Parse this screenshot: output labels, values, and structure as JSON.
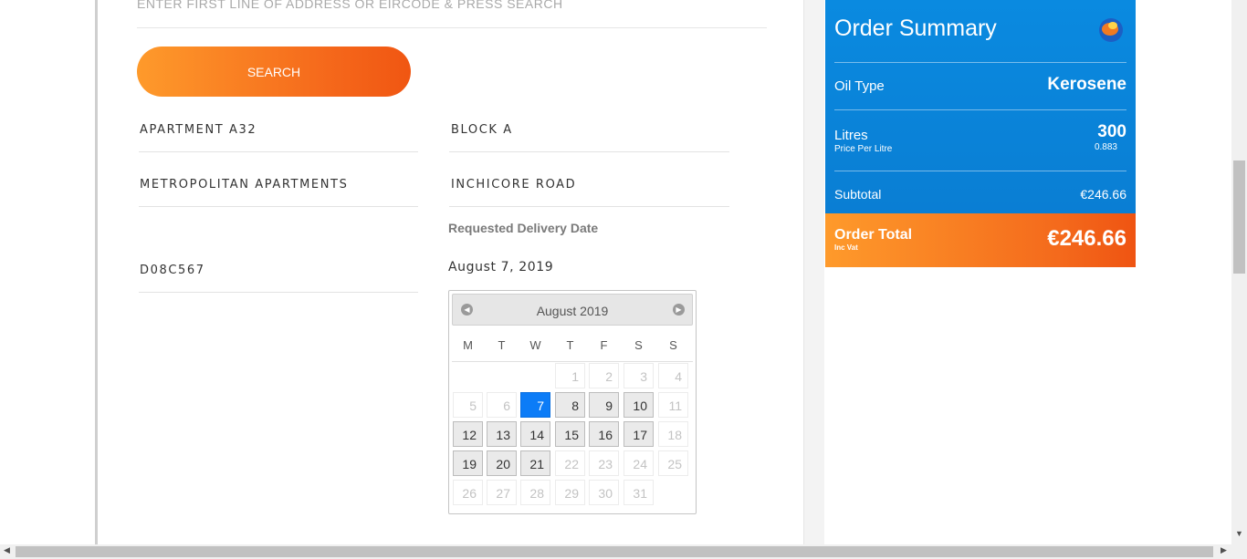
{
  "address": {
    "placeholder": "ENTER FIRST LINE OF ADDRESS OR EIRCODE & PRESS SEARCH",
    "search_label": "SEARCH",
    "line1": "APARTMENT A32",
    "line2": "BLOCK A",
    "line3": "METROPOLITAN APARTMENTS",
    "line4": "INCHICORE ROAD",
    "eircode": "D08C567"
  },
  "delivery": {
    "label": "Requested Delivery Date",
    "value": "August 7, 2019"
  },
  "calendar": {
    "title": "August 2019",
    "prev_icon": "prev-arrow-icon",
    "next_icon": "next-arrow-icon",
    "weekdays": [
      "M",
      "T",
      "W",
      "T",
      "F",
      "S",
      "S"
    ],
    "weeks": [
      [
        null,
        null,
        null,
        {
          "d": "1",
          "s": "off"
        },
        {
          "d": "2",
          "s": "off"
        },
        {
          "d": "3",
          "s": "off"
        },
        {
          "d": "4",
          "s": "off"
        }
      ],
      [
        {
          "d": "5",
          "s": "off"
        },
        {
          "d": "6",
          "s": "off"
        },
        {
          "d": "7",
          "s": "sel"
        },
        {
          "d": "8",
          "s": "on"
        },
        {
          "d": "9",
          "s": "on"
        },
        {
          "d": "10",
          "s": "on"
        },
        {
          "d": "11",
          "s": "off"
        }
      ],
      [
        {
          "d": "12",
          "s": "on"
        },
        {
          "d": "13",
          "s": "on"
        },
        {
          "d": "14",
          "s": "on"
        },
        {
          "d": "15",
          "s": "on"
        },
        {
          "d": "16",
          "s": "on"
        },
        {
          "d": "17",
          "s": "on"
        },
        {
          "d": "18",
          "s": "off"
        }
      ],
      [
        {
          "d": "19",
          "s": "on"
        },
        {
          "d": "20",
          "s": "on"
        },
        {
          "d": "21",
          "s": "on"
        },
        {
          "d": "22",
          "s": "off"
        },
        {
          "d": "23",
          "s": "off"
        },
        {
          "d": "24",
          "s": "off"
        },
        {
          "d": "25",
          "s": "off"
        }
      ],
      [
        {
          "d": "26",
          "s": "off"
        },
        {
          "d": "27",
          "s": "off"
        },
        {
          "d": "28",
          "s": "off"
        },
        {
          "d": "29",
          "s": "off"
        },
        {
          "d": "30",
          "s": "off"
        },
        {
          "d": "31",
          "s": "off"
        },
        null
      ]
    ]
  },
  "summary": {
    "title": "Order Summary",
    "logo_icon": "brand-logo-icon",
    "oil_type_label": "Oil Type",
    "oil_type_value": "Kerosene",
    "litres_label": "Litres",
    "litres_value": "300",
    "ppl_label": "Price Per Litre",
    "ppl_value": "0.883",
    "subtotal_label": "Subtotal",
    "subtotal_value": "€246.66",
    "total_label": "Order Total",
    "total_sub": "Inc Vat",
    "total_value": "€246.66"
  },
  "colors": {
    "accent_orange": "#f5681b",
    "summary_blue": "#0a84d9",
    "selected_day": "#0c7cf7"
  }
}
